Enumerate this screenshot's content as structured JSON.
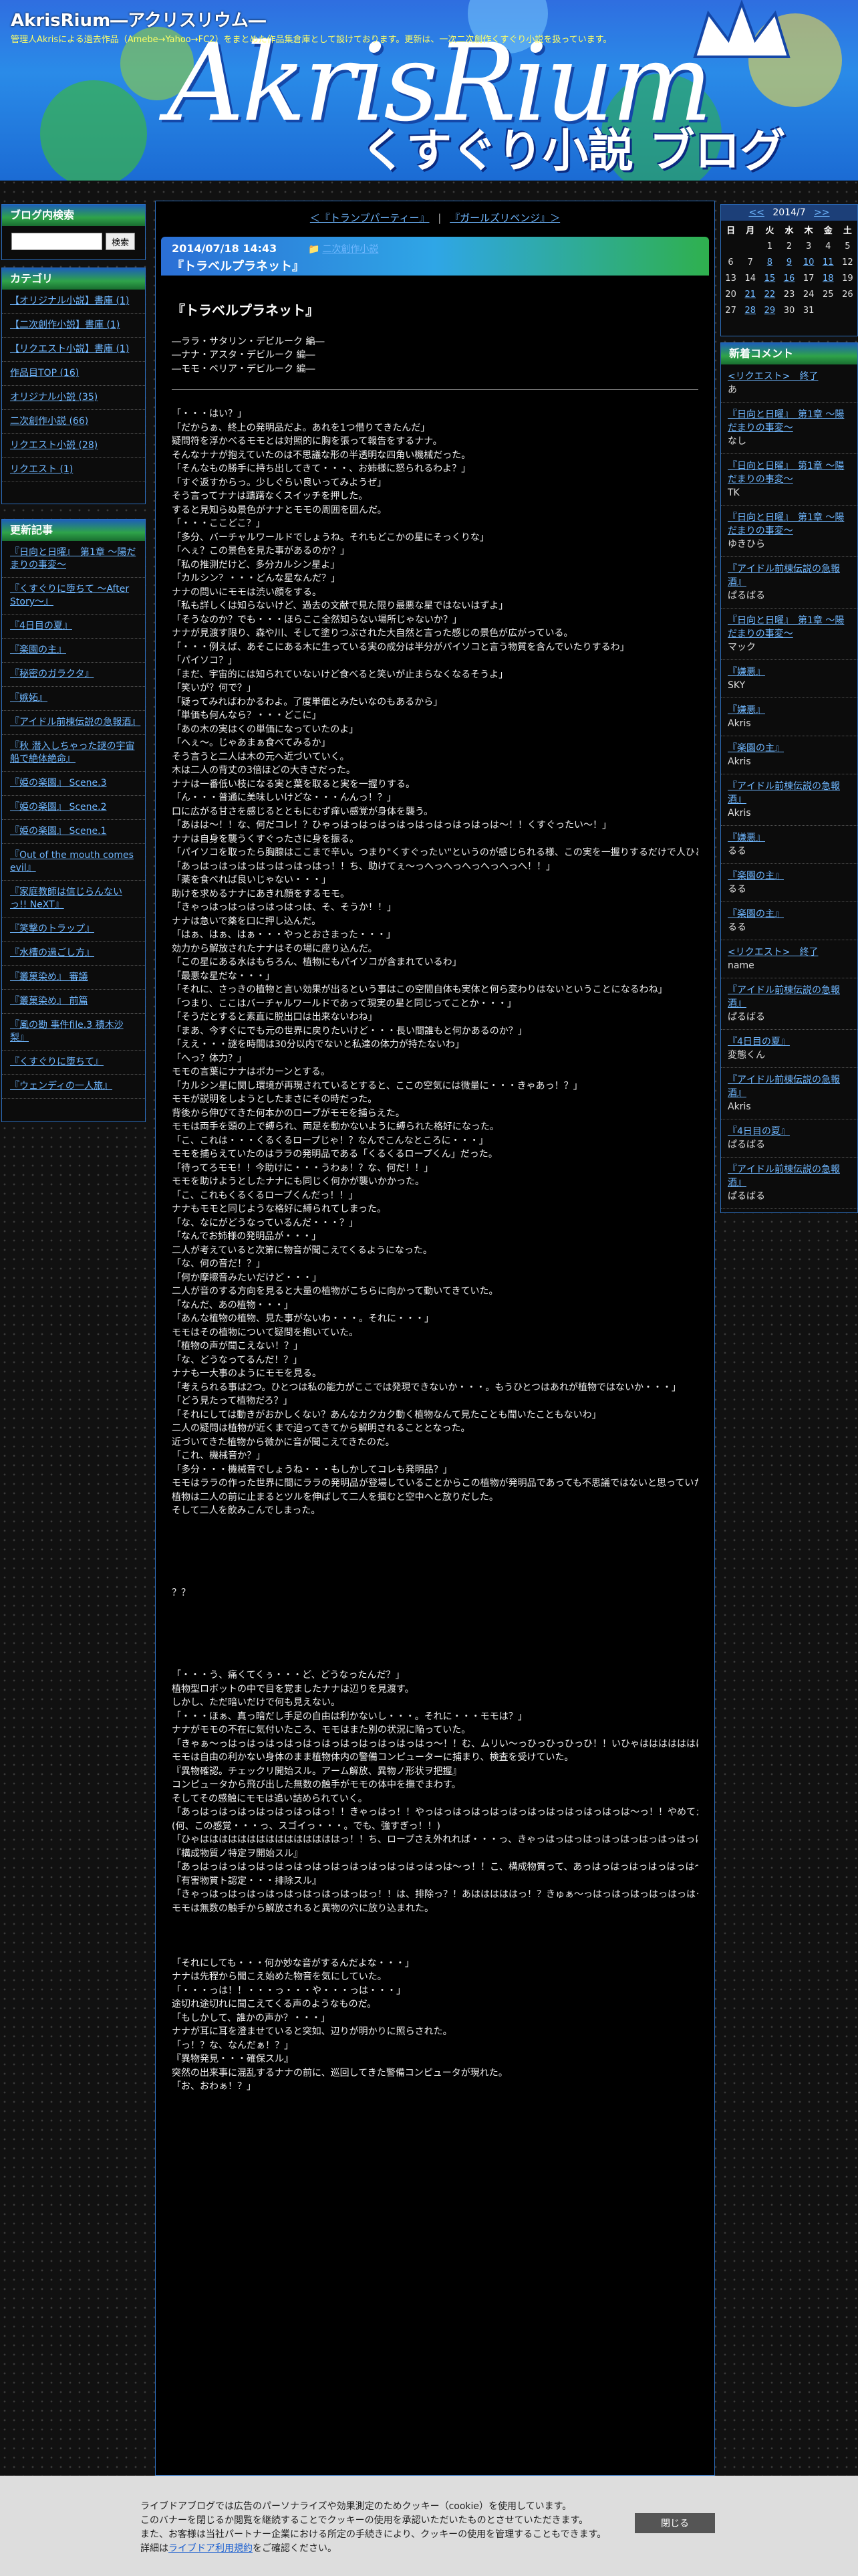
{
  "header": {
    "blog_title": "AkrisRium―アクリスリウム―",
    "description": "管理人Akrisによる過去作品（Amebe→Yahoo→FC2）をまとめた作品集倉庫として設けております。更新は、一次二次創作くすぐり小説を扱っています。",
    "logo_main": "AkrisRium",
    "logo_sub": "くすぐり小説 ブログ"
  },
  "left": {
    "search_title": "ブログ内検索",
    "search_button": "検索",
    "category_title": "カテゴリ",
    "categories": [
      "【オリジナル小説】書庫 (1)",
      "【二次創作小説】書庫 (1)",
      "【リクエスト小説】書庫 (1)",
      "作品目TOP (16)",
      "オリジナル小説 (35)",
      "二次創作小説 (66)",
      "リクエスト小説 (28)",
      "リクエスト (1)"
    ],
    "recent_title": "更新記事",
    "recent": [
      "『日向と日曜』　第1章 ～陽だまりの事変～",
      "『くすぐりに堕ちて ～After Story～』",
      "『4日目の夏』",
      "『楽園の主』",
      "『秘密のガラクタ』",
      "『嫉妬』",
      "『アイドル前棟伝説の急報酒』",
      "『秋 潜入しちゃった謎の宇宙船で絶体絶命』",
      "『姫の楽園』 Scene.3",
      "『姫の楽園』 Scene.2",
      "『姫の楽園』 Scene.1",
      "『Out of the mouth comes evil』",
      "『家庭教師は信じらんないっ!! NeXT』",
      "『笑撃のトラップ』",
      "『水槽の過ごし方』",
      "『叢菓染め』 審議",
      "『叢菓染め』 前篇",
      "『風の勘 事件file.3 積木沙梨』",
      "『くすぐりに堕ちて』",
      "『ウェンディの一人旅』"
    ]
  },
  "center": {
    "prev_link": "＜『トランプパーティー』",
    "next_link": "『ガールズリベンジ』＞",
    "separator": "|",
    "entry_date": "2014/07/18 14:43",
    "entry_title": "『トラベルプラネット』",
    "entry_category": "二次創作小説",
    "story_title": "『トラベルプラネット』",
    "cast": [
      "―ララ・サタリン・デビルーク 編―",
      "―ナナ・アスタ・デビルーク 編―",
      "―モモ・ベリア・デビルーク 編―"
    ],
    "body_part1": [
      "「・・・はい？」",
      "「だからぁ、終上の発明品だよ。あれを1つ借りてきたんだ」",
      "疑問符を浮かべるモモとは対照的に胸を張って報告をするナナ。",
      "そんなナナが抱えていたのは不思議な形の半透明な四角い機械だった。",
      "「そんなもの勝手に持ち出してきて・・・、お姉様に怒られるわよ？」",
      "「すぐ返すからっ。少しぐらい良いってみようぜ」",
      "そう言ってナナは躊躇なくスイッチを押した。",
      "すると見知らぬ景色がナナとモモの周囲を囲んだ。",
      "「・・・ここどこ？」",
      "「多分、バーチャルワールドでしょうね。それもどこかの星にそっくりな」",
      "「へぇ？この景色を見た事があるのか？」",
      "「私の推測だけど、多分カルシン星よ」",
      "「カルシン？・・・どんな星なんだ？」",
      "ナナの問いにモモは渋い顔をする。",
      "「私も詳しくは知らないけど、過去の文献で見た限り最悪な星ではないはずよ」",
      "「そうなのか？でも・・・ほらここ全然知らない場所じゃないか？」",
      "ナナが見渡す限り、森や川、そして塗りつぶされた大自然と言った感じの景色が広がっている。",
      "「・・・例えば、あそこにある木に生っている実の成分は半分がパイソコと言う物質を含んでいたりするわ」",
      "「パイソコ？」",
      "「まだ、宇宙的には知られていないけど食べると笑いが止まらなくなるそうよ」",
      "「笑いが？何で？」",
      "「疑ってみればわかるわよ。了度単価とみたいなのもあるから」",
      "「単価も何んなら？・・・どこに」",
      "「あの木の実はくの単価になっていたのよ」",
      "「へぇ～。じゃあまぁ食べてみるか」",
      "そう言うと二人は木の元へ近づいていく。",
      "木は二人の背丈の3倍ほどの大きさだった。",
      "ナナは一番低い枝になる実と葉を取ると実を一握りする。",
      "「ん・・・普通に美味しいけどな・・・んんっ！？」",
      "口に広がる甘さを感じるとともにむず痒い感覚が身体を襲う。",
      "「あはは～！！な、何だコレ！？ひゃっはっはっはっはっはっはっはっはっは～！！くすぐったい～！」",
      "ナナは自身を襲うくすぐったさに身を振る。",
      "「パイソコを取ったら胸腺はここまで辛い。つまり\"くすぐったい\"というのが感じられる様、この実を一握りするだけで人ひとりを殺傷出来るほどの成分が含まれているわ」",
      "「あっはっはっはっはっはっはっはっ！！ち、助けてぇ～っへっへっへっへっへっへ！！」",
      "「薬を食べれば良いじゃない・・・」",
      "助けを求めるナナにあきれ顔をするモモ。",
      "「きゃっはっはっはっはっはっは、そ、そうか！！」",
      "ナナは急いで薬を口に押し込んだ。",
      "「はぁ、はぁ、はぁ・・・やっとおさまった・・・」",
      "効力から解放されたナナはその場に座り込んだ。",
      "「この星にある水はもちろん、植物にもパイソコが含まれているわ」",
      "「最悪な星だな・・・」",
      "「それに、さっきの植物と言い効果が出るという事はこの空間自体も実体と何ら変わりはないということになるわね」",
      "「つまり、ここはバーチャルワールドであって現実の星と同じってことか・・・」",
      "「そうだとすると素直に脱出口は出来ないわね」",
      "「まあ、今すぐにでも元の世界に戻りたいけど・・・長い間誰もと何かあるのか？」",
      "「ええ・・・謎を時間は30分以内でないと私達の体力が持たないわ」",
      "「へっ？体力？」",
      "モモの言葉にナナはポカーンとする。",
      "「カルシン星に関し環境が再現されているとすると、ここの空気には微量に・・・きゃあっ！？」",
      "モモが説明をしようとしたまさにその時だった。",
      "背後から伸びてきた何本かのロープがモモを捕らえた。",
      "モモは両手を頭の上で縛られ、両足を動かないように縛られた格好になった。",
      "「こ、これは・・・くるくるロープじゃ！？なんでこんなところに・・・」",
      "モモを捕らえていたのはララの発明品である「くるくるロープくん」だった。",
      "「待ってろモモ！！今助けに・・・うわぁ！？な、何だ！！」",
      "モモを助けようとしたナナにも同じく何かが襲いかかった。",
      "「こ、これもくるくるロープくんだっ！！」",
      "ナナもモモと同じような格好に縛られてしまった。",
      "「な、なにがどうなっているんだ・・・？」",
      "「なんでお姉様の発明品が・・・」",
      "二人が考えていると次第に物音が聞こえてくるようになった。",
      "「な、何の音だ！？」",
      "「何か摩擦音みたいだけど・・・」",
      "二人が音のする方向を見ると大量の植物がこちらに向かって動いてきていた。",
      "「なんだ、あの植物・・・」",
      "「あんな植物の植物、見た事がないわ・・・。それに・・・」",
      "モモはその植物について疑問を抱いていた。",
      "「植物の声が聞こえない！？」",
      "「な、どうなってるんだ！？」",
      "ナナも一大事のようにモモを見る。",
      "「考えられる事は2つ。ひとつは私の能力がここでは発現できないか・・・。もうひとつはあれが植物ではないか・・・」",
      "「どう見たって植物だろ？」",
      "「それにしては動きがおかしくない？あんなカクカク動く植物なんて見たことも聞いたこともないわ」",
      "二人の疑問は植物が近くまで迫ってきてから解明されることとなった。",
      "近づいてきた植物から微かに音が聞こえてきたのだ。",
      "「これ、機械音か？」",
      "「多分・・・機械音でしょうね・・・もしかしてコレも発明品？」",
      "モモはララの作った世界に間にララの発明品が登場していることからこの植物が発明品であっても不思議ではないと思っていた。",
      "植物は二人の前に止まるとツルを伸ばして二人を掴むと空中へと放りだした。",
      "そして二人を飲みこんでしまった。"
    ],
    "body_marks": "？？",
    "body_part2": [
      "「・・・う、痛くてくぅ・・・ど、どうなったんだ？」",
      "植物型ロボットの中で目を覚ましたナナは辺りを見渡す。",
      "しかし、ただ暗いだけで何も見えない。",
      "「・・・ほぁ、真っ暗だし手足の自由は利かないし・・・。それに・・・モモは？」",
      "ナナがモモの不在に気付いたころ、モモはまた別の状況に陥っていた。",
      "「きゃぁ～っはっはっはっはっはっはっはっはっはっはっはっ～！！む、ムリい～っひっひっひっひ！！いひゃはははははははははははははははははっ！！」",
      "モモは自由の利かない身体のまま植物体内の警備コンピューターに捕まり、検査を受けていた。",
      "『異物確認。チェックリ開始スル。アーム解放、異物ノ形状ヲ把握』",
      "コンピュータから飛び出した無数の触手がモモの体中を撫でまわす。",
      "そしてその感触にモモは追い詰められていく。",
      "「あっはっはっはっはっはっはっはっ！！きゃっはっ！！やっはっはっはっはっはっはっはっはっはっはっは～っ！！やめてえ～っ！！」",
      "(何、この感覚・・・っ、スゴイっ・・・。でも、強すぎっ！！)",
      "「ひゃはははははははははははははははっ！！ち、ロープさえ外れれば・・・っ、きゃっはっはっはっはっはっはっはっはっはっはっは～っ！！」",
      "『構成物質ノ特定ヲ開始スル』",
      "「あっはっはっはっはっはっはっはっはっはっはっはっはっはっは～っ！！こ、構成物質って、あっはっはっはっはっはっは～っ！！」",
      "『有害物質ト認定・・・排除スル』",
      "「きゃっはっはっはっはっはっはっはっはっはっ！！は、排除っ？！あはははははっ！？きゅぁ～っはっはっはっはっはっはっはっはっはっは～っ！！」",
      "モモは無数の触手から解放されると異物の穴に放り込まれた。"
    ],
    "body_part3": [
      "「それにしても・・・何か妙な音がするんだよな・・・」",
      "ナナは先程から聞こえ始めた物音を気にしていた。",
      "「・・・っは！！・・・っ・・・や・・・っは・・・」",
      "途切れ途切れに聞こえてくる声のようなものだ。",
      "「もしかして、誰かの声か？・・・」",
      "ナナが耳に耳を澄ませていると突如、辺りが明かりに照らされた。",
      "「っ！？な、なんだぁ！？」",
      "『異物発見・・・確保スル』",
      "突然の出来事に混乱するナナの前に、巡回してきた警備コンピュータが現れた。",
      "「お、おわぁ！？」"
    ]
  },
  "right": {
    "calendar": {
      "prev": "<<",
      "month": "2014/7",
      "next": ">>",
      "weekdays": [
        "日",
        "月",
        "火",
        "水",
        "木",
        "金",
        "土"
      ],
      "weeks": [
        [
          "",
          "",
          "1",
          "2",
          "3",
          "4",
          "5"
        ],
        [
          "6",
          "7",
          "8",
          "9",
          "10",
          "11",
          "12"
        ],
        [
          "13",
          "14",
          "15",
          "16",
          "17",
          "18",
          "19"
        ],
        [
          "20",
          "21",
          "22",
          "23",
          "24",
          "25",
          "26"
        ],
        [
          "27",
          "28",
          "29",
          "30",
          "31",
          "",
          ""
        ]
      ],
      "linked_days": [
        "8",
        "9",
        "10",
        "11",
        "15",
        "16",
        "18",
        "21",
        "22",
        "28",
        "29"
      ]
    },
    "comments_title": "新着コメント",
    "comments": [
      {
        "title": "<リクエスト>　終了",
        "name": "あ"
      },
      {
        "title": "『日向と日曜』　第1章 ～陽だまりの事変～",
        "name": "なし"
      },
      {
        "title": "『日向と日曜』　第1章 ～陽だまりの事変～",
        "name": "TK"
      },
      {
        "title": "『日向と日曜』　第1章 ～陽だまりの事変～",
        "name": "ゆきひら"
      },
      {
        "title": "『アイドル前棟伝説の急報酒』",
        "name": "ぱるばる"
      },
      {
        "title": "『日向と日曜』　第1章 ～陽だまりの事変～",
        "name": "マック"
      },
      {
        "title": "『嫌悪』",
        "name": "SKY"
      },
      {
        "title": "『嫌悪』",
        "name": "Akris"
      },
      {
        "title": "『楽園の主』",
        "name": "Akris"
      },
      {
        "title": "『アイドル前棟伝説の急報酒』",
        "name": "Akris"
      },
      {
        "title": "『嫌悪』",
        "name": "るる"
      },
      {
        "title": "『楽園の主』",
        "name": "るる"
      },
      {
        "title": "『楽園の主』",
        "name": "るる"
      },
      {
        "title": "<リクエスト>　終了",
        "name": "name"
      },
      {
        "title": "『アイドル前棟伝説の急報酒』",
        "name": "ぱるばる"
      },
      {
        "title": "『4日目の夏』",
        "name": "変態くん"
      },
      {
        "title": "『アイドル前棟伝説の急報酒』",
        "name": "Akris"
      },
      {
        "title": "『4日目の夏』",
        "name": "ぱるばる"
      },
      {
        "title": "『アイドル前棟伝説の急報酒』",
        "name": "ぱるばる"
      }
    ]
  },
  "cookie": {
    "lines": [
      "ライブドアブログでは広告のパーソナライズや効果測定のためクッキー（cookie）を使用しています。",
      "このバナーを閉じるか閲覧を継続することでクッキーの使用を承認いただいたものとさせていただきます。",
      "また、お客様は当社パートナー企業における所定の手続きにより、クッキーの使用を管理することもできます。"
    ],
    "detail_prefix": "詳細は",
    "detail_link": "ライブドア利用規約",
    "detail_suffix": "をご確認ください。",
    "close_button": "閉じる"
  },
  "colors": {
    "link": "#6fb7ff",
    "accent_blue": "#2d6fbf",
    "accent_green": "#2fa34a"
  }
}
